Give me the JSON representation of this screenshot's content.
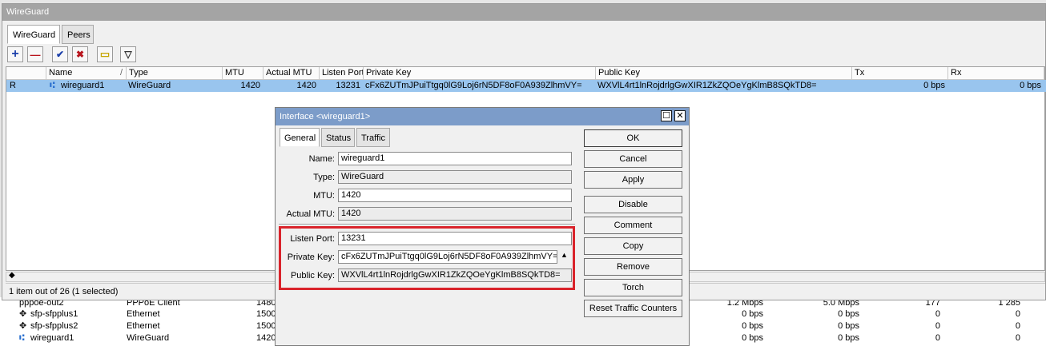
{
  "window": {
    "title": "WireGuard"
  },
  "tabs": [
    "WireGuard",
    "Peers"
  ],
  "toolbar": [
    {
      "name": "add",
      "glyph": "+",
      "color": "#1b3faa"
    },
    {
      "name": "remove",
      "glyph": "—",
      "color": "#b8141c"
    },
    {
      "name": "enable",
      "glyph": "✔",
      "color": "#1b3faa"
    },
    {
      "name": "disable",
      "glyph": "✖",
      "color": "#b8141c"
    },
    {
      "name": "comment",
      "glyph": "▭",
      "color": "#c6a600"
    },
    {
      "name": "filter",
      "glyph": "▽",
      "color": "#333333"
    }
  ],
  "table": {
    "headers": [
      "",
      "Name",
      "Type",
      "MTU",
      "Actual MTU",
      "Listen Port",
      "Private Key",
      "Public Key",
      "Tx",
      "Rx"
    ],
    "sort_indicator": "/",
    "row": {
      "flag": "R",
      "name": "wireguard1",
      "type": "WireGuard",
      "mtu": "1420",
      "actual_mtu": "1420",
      "listen_port": "13231",
      "private_key": "cFx6ZUTmJPuiTtgq0lG9Loj6rN5DF8oF0A939ZlhmVY=",
      "public_key": "WXVlL4rt1lnRojdrlgGwXIR1ZkZQOeYgKlmB8SQkTD8=",
      "tx": "0 bps",
      "rx": "0 bps"
    }
  },
  "status_bar": "1 item out of 26 (1 selected)",
  "background_rows": [
    {
      "name": "pppoe-out2",
      "type": "PPPoE Client",
      "mtu": "1480",
      "tx": "1.2 Mbps",
      "rx": "5.0 Mbps",
      "a": "177",
      "b": "1 285"
    },
    {
      "name": "sfp-sfpplus1",
      "type": "Ethernet",
      "mtu": "1500",
      "tx": "0 bps",
      "rx": "0 bps",
      "a": "0",
      "b": "0"
    },
    {
      "name": "sfp-sfpplus2",
      "type": "Ethernet",
      "mtu": "1500",
      "tx": "0 bps",
      "rx": "0 bps",
      "a": "0",
      "b": "0"
    },
    {
      "name": "wireguard1",
      "type": "WireGuard",
      "mtu": "1420",
      "tx": "0 bps",
      "rx": "0 bps",
      "a": "0",
      "b": "0"
    }
  ],
  "dialog": {
    "title": "Interface <wireguard1>",
    "tabs": [
      "General",
      "Status",
      "Traffic"
    ],
    "fields": {
      "name": {
        "label": "Name:",
        "value": "wireguard1"
      },
      "type": {
        "label": "Type:",
        "value": "WireGuard"
      },
      "mtu": {
        "label": "MTU:",
        "value": "1420"
      },
      "actual_mtu": {
        "label": "Actual MTU:",
        "value": "1420"
      },
      "listen_port": {
        "label": "Listen Port:",
        "value": "13231"
      },
      "private_key": {
        "label": "Private Key:",
        "value": "cFx6ZUTmJPuiTtgq0lG9Loj6rN5DF8oF0A939ZlhmVY="
      },
      "public_key": {
        "label": "Public Key:",
        "value": "WXVlL4rt1lnRojdrlgGwXIR1ZkZQOeYgKlmB8SQkTD8="
      }
    },
    "buttons": [
      "OK",
      "Cancel",
      "Apply",
      "Disable",
      "Comment",
      "Copy",
      "Remove",
      "Torch",
      "Reset Traffic Counters"
    ]
  },
  "colors": {
    "selection": "#99c5ee",
    "dialog_title": "#7c9cc9",
    "highlight": "#d9232b"
  }
}
